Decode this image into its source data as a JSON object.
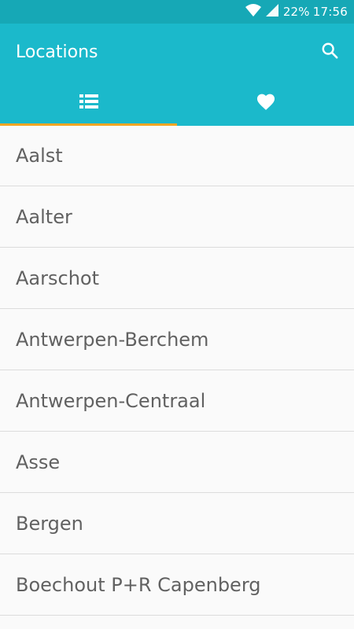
{
  "status_bar": {
    "battery": "22%",
    "time": "17:56",
    "icons": [
      "wifi-icon",
      "cell-signal-icon"
    ]
  },
  "app_bar": {
    "title": "Locations",
    "search_icon": "search-icon",
    "tabs": [
      {
        "icon": "list-icon",
        "active": true
      },
      {
        "icon": "heart-icon",
        "active": false
      }
    ]
  },
  "list": {
    "items": [
      {
        "label": "Aalst"
      },
      {
        "label": "Aalter"
      },
      {
        "label": "Aarschot"
      },
      {
        "label": "Antwerpen-Berchem"
      },
      {
        "label": "Antwerpen-Centraal"
      },
      {
        "label": "Asse"
      },
      {
        "label": "Bergen"
      },
      {
        "label": "Boechout P+R Capenberg"
      }
    ]
  },
  "colors": {
    "status_bar": "#16a8b6",
    "app_bar": "#1bb9cb",
    "tab_indicator": "#f6a623",
    "list_text": "#616161"
  }
}
